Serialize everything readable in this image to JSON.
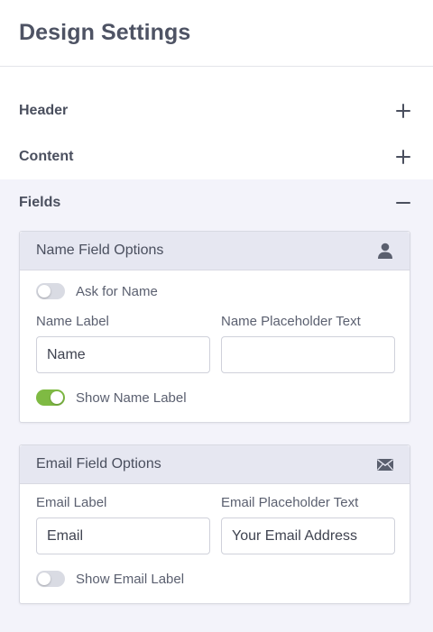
{
  "page": {
    "title": "Design Settings"
  },
  "accordion": {
    "header": {
      "label": "Header",
      "state": "collapsed",
      "icon": "plus-icon"
    },
    "content": {
      "label": "Content",
      "state": "collapsed",
      "icon": "plus-icon"
    },
    "fields": {
      "label": "Fields",
      "state": "expanded",
      "icon": "minus-icon"
    }
  },
  "name_panel": {
    "title": "Name Field Options",
    "icon": "user-icon",
    "ask_toggle": {
      "label": "Ask for Name",
      "on": false
    },
    "label_field": {
      "label": "Name Label",
      "value": "Name",
      "placeholder": ""
    },
    "placeholder_field": {
      "label": "Name Placeholder Text",
      "value": "",
      "placeholder": ""
    },
    "show_label_toggle": {
      "label": "Show Name Label",
      "on": true
    }
  },
  "email_panel": {
    "title": "Email Field Options",
    "icon": "envelope-icon",
    "label_field": {
      "label": "Email Label",
      "value": "Email",
      "placeholder": ""
    },
    "placeholder_field": {
      "label": "Email Placeholder Text",
      "value": "Your Email Address",
      "placeholder": ""
    },
    "show_label_toggle": {
      "label": "Show Email Label",
      "on": false
    }
  },
  "colors": {
    "toggle_on": "#7fba43",
    "toggle_off": "#d9dbe3",
    "section_bg": "#f3f3fa",
    "panel_header_bg": "#e6e7f1",
    "title_text": "#4e5364"
  }
}
